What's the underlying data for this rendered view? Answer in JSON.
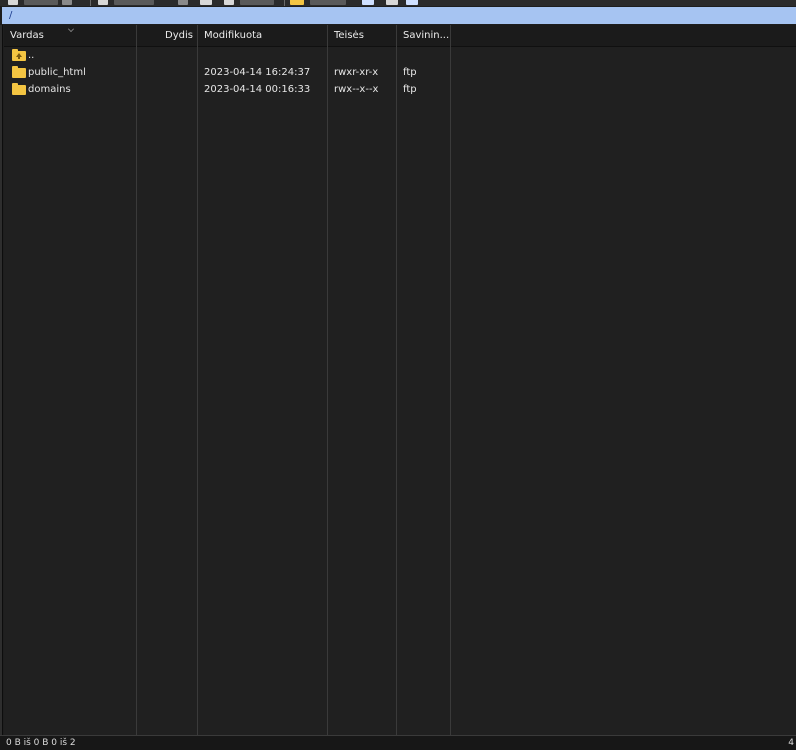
{
  "path_bar": {
    "path": "/"
  },
  "columns": [
    {
      "key": "name",
      "label": "Vardas"
    },
    {
      "key": "size",
      "label": "Dydis"
    },
    {
      "key": "modified",
      "label": "Modifikuota"
    },
    {
      "key": "permissions",
      "label": "Teisės"
    },
    {
      "key": "owner",
      "label": "Savinin..."
    }
  ],
  "files": [
    {
      "name": "..",
      "size": "",
      "modified": "",
      "permissions": "",
      "owner": "",
      "icon": "folder-up-icon"
    },
    {
      "name": "public_html",
      "size": "",
      "modified": "2023-04-14 16:24:37",
      "permissions": "rwxr-xr-x",
      "owner": "ftp",
      "icon": "folder-icon"
    },
    {
      "name": "domains",
      "size": "",
      "modified": "2023-04-14 00:16:33",
      "permissions": "rwx--x--x",
      "owner": "ftp",
      "icon": "folder-icon"
    }
  ],
  "status": {
    "left": "0 B iš 0 B 0 iš 2",
    "right": "4"
  },
  "colors": {
    "path_bar_bg": "#a6c4f2",
    "folder": "#f4c542",
    "list_bg": "#202020"
  }
}
